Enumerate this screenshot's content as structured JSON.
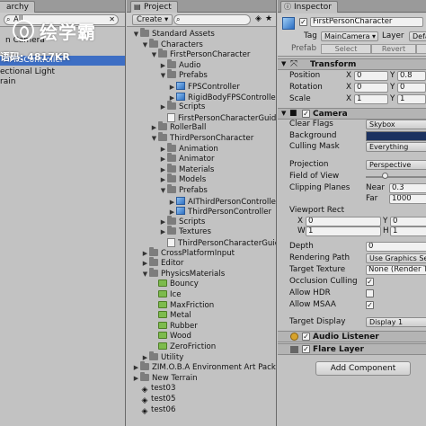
{
  "hierarchy": {
    "tab_label": "archy",
    "search_value": "All",
    "rows": [
      "n Camera",
      "FPSController",
      "ectional Light",
      "rain"
    ]
  },
  "watermark": {
    "brand": "绘学霸",
    "code": "语码: 4817KR"
  },
  "project": {
    "tab_label": "Project",
    "create_label": "Create",
    "tree": [
      {
        "label": "Standard Assets",
        "icon": "folder",
        "arrow": "▼",
        "level": 0
      },
      {
        "label": "Characters",
        "icon": "folder",
        "arrow": "▼",
        "level": 1
      },
      {
        "label": "FirstPersonCharacter",
        "icon": "folder",
        "arrow": "▼",
        "level": 2
      },
      {
        "label": "Audio",
        "icon": "folder",
        "arrow": "▶",
        "level": 3
      },
      {
        "label": "Prefabs",
        "icon": "folder",
        "arrow": "▼",
        "level": 3
      },
      {
        "label": "FPSController",
        "icon": "prefab",
        "arrow": "▶",
        "level": 4
      },
      {
        "label": "RigidBodyFPSController",
        "icon": "prefab",
        "arrow": "▶",
        "level": 4
      },
      {
        "label": "Scripts",
        "icon": "folder",
        "arrow": "▶",
        "level": 3
      },
      {
        "label": "FirstPersonCharacterGuide",
        "icon": "script",
        "arrow": "",
        "level": 3
      },
      {
        "label": "RollerBall",
        "icon": "folder",
        "arrow": "▶",
        "level": 2
      },
      {
        "label": "ThirdPersonCharacter",
        "icon": "folder",
        "arrow": "▼",
        "level": 2
      },
      {
        "label": "Animation",
        "icon": "folder",
        "arrow": "▶",
        "level": 3
      },
      {
        "label": "Animator",
        "icon": "folder",
        "arrow": "▶",
        "level": 3
      },
      {
        "label": "Materials",
        "icon": "folder",
        "arrow": "▶",
        "level": 3
      },
      {
        "label": "Models",
        "icon": "folder",
        "arrow": "▶",
        "level": 3
      },
      {
        "label": "Prefabs",
        "icon": "folder",
        "arrow": "▼",
        "level": 3
      },
      {
        "label": "AIThirdPersonController",
        "icon": "prefab",
        "arrow": "▶",
        "level": 4
      },
      {
        "label": "ThirdPersonController",
        "icon": "prefab",
        "arrow": "▶",
        "level": 4
      },
      {
        "label": "Scripts",
        "icon": "folder",
        "arrow": "▶",
        "level": 3
      },
      {
        "label": "Textures",
        "icon": "folder",
        "arrow": "▶",
        "level": 3
      },
      {
        "label": "ThirdPersonCharacterGuide",
        "icon": "script",
        "arrow": "",
        "level": 3
      },
      {
        "label": "CrossPlatformInput",
        "icon": "folder",
        "arrow": "▶",
        "level": 1
      },
      {
        "label": "Editor",
        "icon": "folder",
        "arrow": "▶",
        "level": 1
      },
      {
        "label": "PhysicsMaterials",
        "icon": "folder",
        "arrow": "▼",
        "level": 1
      },
      {
        "label": "Bouncy",
        "icon": "phys",
        "arrow": "",
        "level": 2
      },
      {
        "label": "Ice",
        "icon": "phys",
        "arrow": "",
        "level": 2
      },
      {
        "label": "MaxFriction",
        "icon": "phys",
        "arrow": "",
        "level": 2
      },
      {
        "label": "Metal",
        "icon": "phys",
        "arrow": "",
        "level": 2
      },
      {
        "label": "Rubber",
        "icon": "phys",
        "arrow": "",
        "level": 2
      },
      {
        "label": "Wood",
        "icon": "phys",
        "arrow": "",
        "level": 2
      },
      {
        "label": "ZeroFriction",
        "icon": "phys",
        "arrow": "",
        "level": 2
      },
      {
        "label": "Utility",
        "icon": "folder",
        "arrow": "▶",
        "level": 1
      },
      {
        "label": "ZIM.O.B.A Environment Art Pack",
        "icon": "folder",
        "arrow": "▶",
        "level": 0
      },
      {
        "label": "New Terrain",
        "icon": "folder",
        "arrow": "▶",
        "level": 0
      },
      {
        "label": "test03",
        "icon": "scene",
        "arrow": "",
        "level": 0
      },
      {
        "label": "test05",
        "icon": "scene",
        "arrow": "",
        "level": 0
      },
      {
        "label": "test06",
        "icon": "scene",
        "arrow": "",
        "level": 0
      }
    ]
  },
  "inspector": {
    "tab_label": "Inspector",
    "object_name": "FirstPersonCharacter",
    "tag_label": "Tag",
    "tag_value": "MainCamera",
    "layer_label": "Layer",
    "layer_value": "Defa",
    "prefab_label": "Prefab",
    "prefab_select": "Select",
    "prefab_revert": "Revert",
    "transform": {
      "title": "Transform",
      "position_label": "Position",
      "rotation_label": "Rotation",
      "scale_label": "Scale",
      "position": {
        "x": "0",
        "y": "0.8"
      },
      "rotation": {
        "x": "0",
        "y": "0"
      },
      "scale": {
        "x": "1",
        "y": "1"
      }
    },
    "camera": {
      "title": "Camera",
      "clear_flags_label": "Clear Flags",
      "clear_flags_value": "Skybox",
      "background_label": "Background",
      "background_color": "#1c3260",
      "culling_mask_label": "Culling Mask",
      "culling_mask_value": "Everything",
      "projection_label": "Projection",
      "projection_value": "Perspective",
      "fov_label": "Field of View",
      "fov_value": 0.3,
      "clipping_label": "Clipping Planes",
      "near_label": "Near",
      "near_value": "0.3",
      "far_label": "Far",
      "far_value": "1000",
      "viewport_label": "Viewport Rect",
      "vx_label": "X",
      "vx": "0",
      "vy_label": "Y",
      "vy": "0",
      "vw_label": "W",
      "vw": "1",
      "vh_label": "H",
      "vh": "1",
      "depth_label": "Depth",
      "depth_value": "0",
      "rendering_path_label": "Rendering Path",
      "rendering_path_value": "Use Graphics Set",
      "target_texture_label": "Target Texture",
      "target_texture_value": "None (Render T",
      "occlusion_label": "Occlusion Culling",
      "hdr_label": "Allow HDR",
      "msaa_label": "Allow MSAA",
      "target_display_label": "Target Display",
      "target_display_value": "Display 1"
    },
    "audio_listener": "Audio Listener",
    "flare_layer": "Flare Layer",
    "add_component": "Add Component"
  }
}
